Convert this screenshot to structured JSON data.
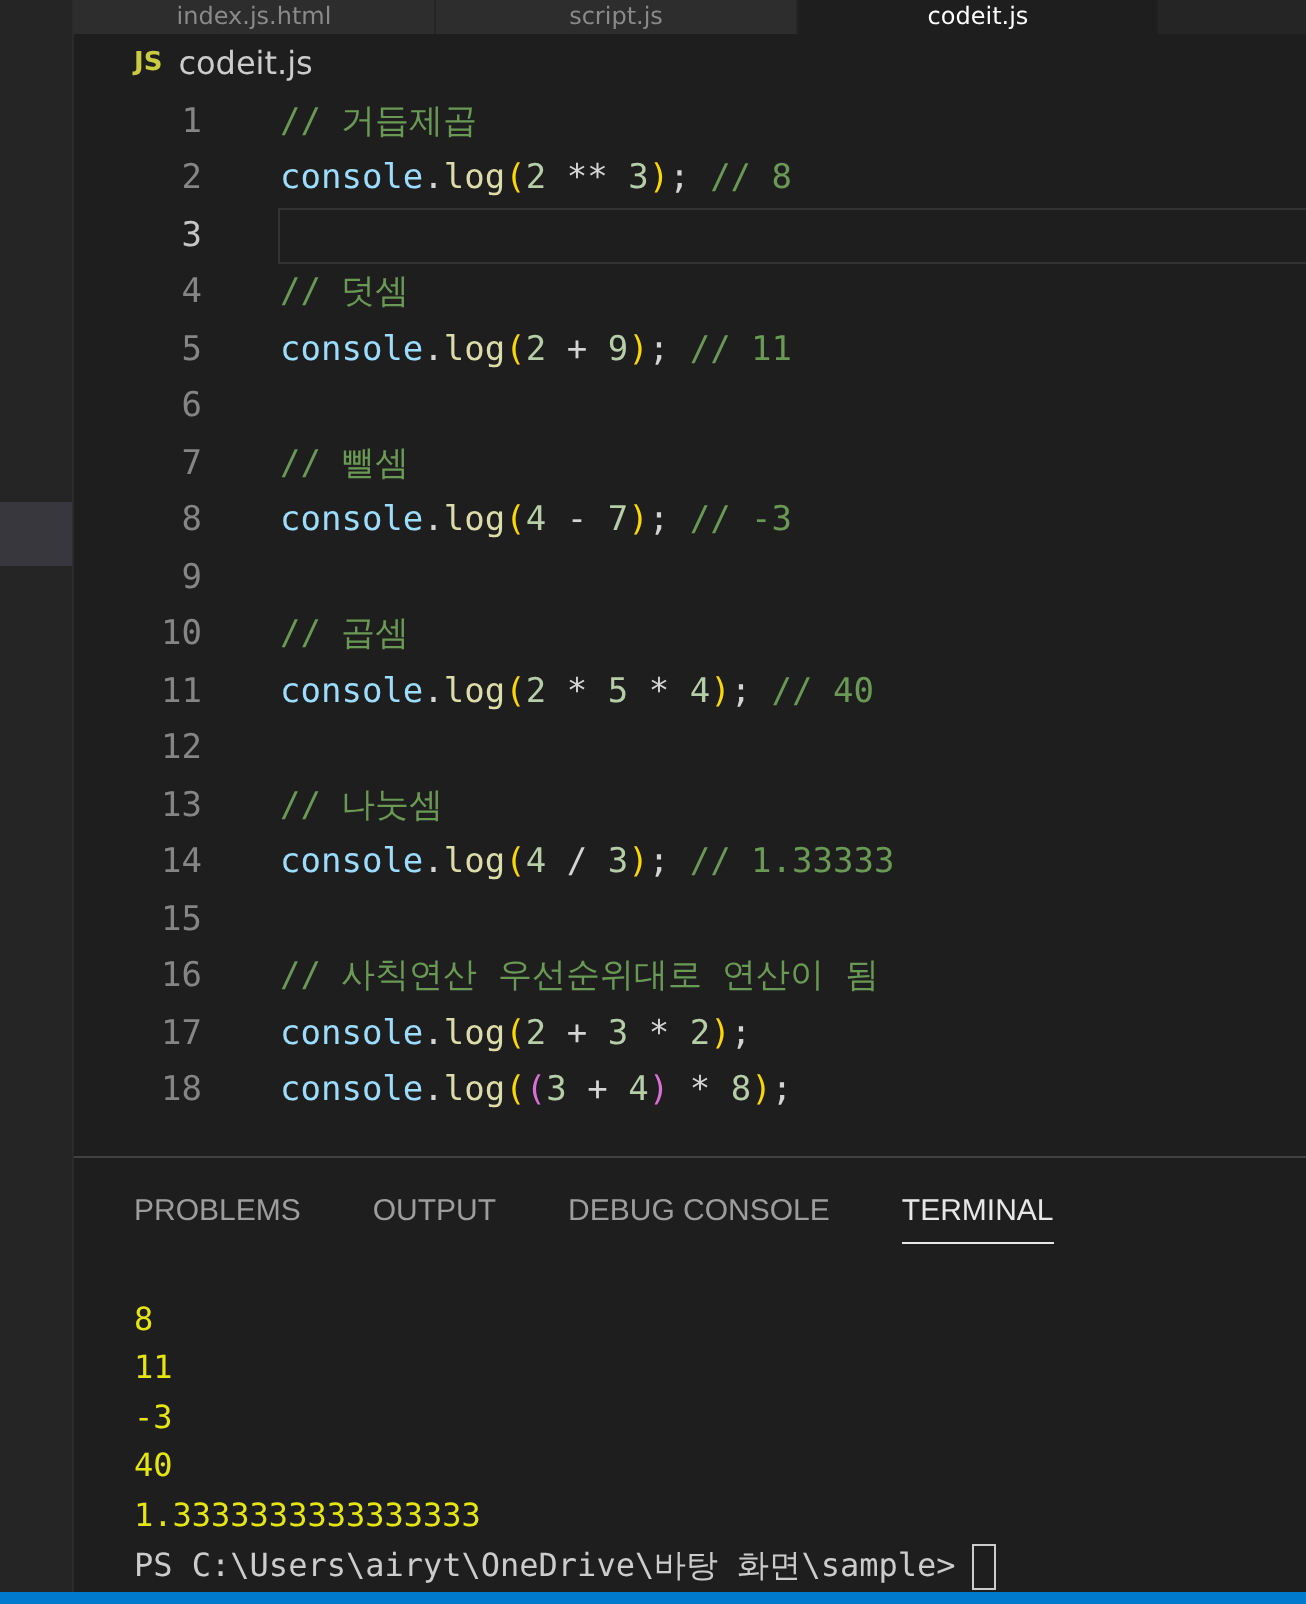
{
  "tabs": [
    {
      "label": "index.js.html",
      "selected": false
    },
    {
      "label": "script.js",
      "selected": false
    },
    {
      "label": "codeit.js",
      "selected": true
    }
  ],
  "breadcrumb": {
    "badge": "JS",
    "file": "codeit.js"
  },
  "sidebar": {
    "items": [
      {
        "selected": true
      }
    ]
  },
  "code_lines": [
    {
      "number": "1",
      "current": false,
      "tokens": [
        {
          "kind": "comment",
          "text": "// 거듭제곱"
        }
      ]
    },
    {
      "number": "2",
      "current": false,
      "tokens": [
        {
          "kind": "var",
          "text": "console"
        },
        {
          "kind": "punct",
          "text": "."
        },
        {
          "kind": "func",
          "text": "log"
        },
        {
          "kind": "bracket1",
          "text": "("
        },
        {
          "kind": "number",
          "text": "2"
        },
        {
          "kind": "punct",
          "text": " ** "
        },
        {
          "kind": "number",
          "text": "3"
        },
        {
          "kind": "bracket1",
          "text": ")"
        },
        {
          "kind": "punct",
          "text": "; "
        },
        {
          "kind": "comment",
          "text": "// 8"
        }
      ]
    },
    {
      "number": "3",
      "current": true
    },
    {
      "number": "4",
      "current": false,
      "tokens": [
        {
          "kind": "comment",
          "text": "// 덧셈"
        }
      ]
    },
    {
      "number": "5",
      "current": false,
      "tokens": [
        {
          "kind": "var",
          "text": "console"
        },
        {
          "kind": "punct",
          "text": "."
        },
        {
          "kind": "func",
          "text": "log"
        },
        {
          "kind": "bracket1",
          "text": "("
        },
        {
          "kind": "number",
          "text": "2"
        },
        {
          "kind": "punct",
          "text": " + "
        },
        {
          "kind": "number",
          "text": "9"
        },
        {
          "kind": "bracket1",
          "text": ")"
        },
        {
          "kind": "punct",
          "text": "; "
        },
        {
          "kind": "comment",
          "text": "// 11"
        }
      ]
    },
    {
      "number": "6",
      "current": false
    },
    {
      "number": "7",
      "current": false,
      "tokens": [
        {
          "kind": "comment",
          "text": "// 뺄셈"
        }
      ]
    },
    {
      "number": "8",
      "current": false,
      "tokens": [
        {
          "kind": "var",
          "text": "console"
        },
        {
          "kind": "punct",
          "text": "."
        },
        {
          "kind": "func",
          "text": "log"
        },
        {
          "kind": "bracket1",
          "text": "("
        },
        {
          "kind": "number",
          "text": "4"
        },
        {
          "kind": "punct",
          "text": " - "
        },
        {
          "kind": "number",
          "text": "7"
        },
        {
          "kind": "bracket1",
          "text": ")"
        },
        {
          "kind": "punct",
          "text": "; "
        },
        {
          "kind": "comment",
          "text": "// -3"
        }
      ]
    },
    {
      "number": "9",
      "current": false
    },
    {
      "number": "10",
      "current": false,
      "tokens": [
        {
          "kind": "comment",
          "text": "// 곱셈"
        }
      ]
    },
    {
      "number": "11",
      "current": false,
      "tokens": [
        {
          "kind": "var",
          "text": "console"
        },
        {
          "kind": "punct",
          "text": "."
        },
        {
          "kind": "func",
          "text": "log"
        },
        {
          "kind": "bracket1",
          "text": "("
        },
        {
          "kind": "number",
          "text": "2"
        },
        {
          "kind": "punct",
          "text": " * "
        },
        {
          "kind": "number",
          "text": "5"
        },
        {
          "kind": "punct",
          "text": " * "
        },
        {
          "kind": "number",
          "text": "4"
        },
        {
          "kind": "bracket1",
          "text": ")"
        },
        {
          "kind": "punct",
          "text": "; "
        },
        {
          "kind": "comment",
          "text": "// 40"
        }
      ]
    },
    {
      "number": "12",
      "current": false
    },
    {
      "number": "13",
      "current": false,
      "tokens": [
        {
          "kind": "comment",
          "text": "// 나눗셈"
        }
      ]
    },
    {
      "number": "14",
      "current": false,
      "tokens": [
        {
          "kind": "var",
          "text": "console"
        },
        {
          "kind": "punct",
          "text": "."
        },
        {
          "kind": "func",
          "text": "log"
        },
        {
          "kind": "bracket1",
          "text": "("
        },
        {
          "kind": "number",
          "text": "4"
        },
        {
          "kind": "punct",
          "text": " / "
        },
        {
          "kind": "number",
          "text": "3"
        },
        {
          "kind": "bracket1",
          "text": ")"
        },
        {
          "kind": "punct",
          "text": "; "
        },
        {
          "kind": "comment",
          "text": "// 1.33333"
        }
      ]
    },
    {
      "number": "15",
      "current": false
    },
    {
      "number": "16",
      "current": false,
      "tokens": [
        {
          "kind": "comment",
          "text": "// 사칙연산 우선순위대로 연산이 됨"
        }
      ]
    },
    {
      "number": "17",
      "current": false,
      "tokens": [
        {
          "kind": "var",
          "text": "console"
        },
        {
          "kind": "punct",
          "text": "."
        },
        {
          "kind": "func",
          "text": "log"
        },
        {
          "kind": "bracket1",
          "text": "("
        },
        {
          "kind": "number",
          "text": "2"
        },
        {
          "kind": "punct",
          "text": " + "
        },
        {
          "kind": "number",
          "text": "3"
        },
        {
          "kind": "punct",
          "text": " * "
        },
        {
          "kind": "number",
          "text": "2"
        },
        {
          "kind": "bracket1",
          "text": ")"
        },
        {
          "kind": "punct",
          "text": ";"
        }
      ]
    },
    {
      "number": "18",
      "current": false,
      "tokens": [
        {
          "kind": "var",
          "text": "console"
        },
        {
          "kind": "punct",
          "text": "."
        },
        {
          "kind": "func",
          "text": "log"
        },
        {
          "kind": "bracket1",
          "text": "("
        },
        {
          "kind": "bracket2",
          "text": "("
        },
        {
          "kind": "number",
          "text": "3"
        },
        {
          "kind": "punct",
          "text": " + "
        },
        {
          "kind": "number",
          "text": "4"
        },
        {
          "kind": "bracket2",
          "text": ")"
        },
        {
          "kind": "punct",
          "text": " * "
        },
        {
          "kind": "number",
          "text": "8"
        },
        {
          "kind": "bracket1",
          "text": ")"
        },
        {
          "kind": "punct",
          "text": ";"
        }
      ]
    }
  ],
  "panel_tabs": [
    {
      "label": "PROBLEMS",
      "selected": false
    },
    {
      "label": "OUTPUT",
      "selected": false
    },
    {
      "label": "DEBUG CONSOLE",
      "selected": false
    },
    {
      "label": "TERMINAL",
      "selected": true
    }
  ],
  "terminal": {
    "output": [
      "8",
      "11",
      "-3",
      "40",
      "1.3333333333333333"
    ],
    "prompt": "PS C:\\Users\\airyt\\OneDrive\\바탕 화면\\sample>"
  }
}
